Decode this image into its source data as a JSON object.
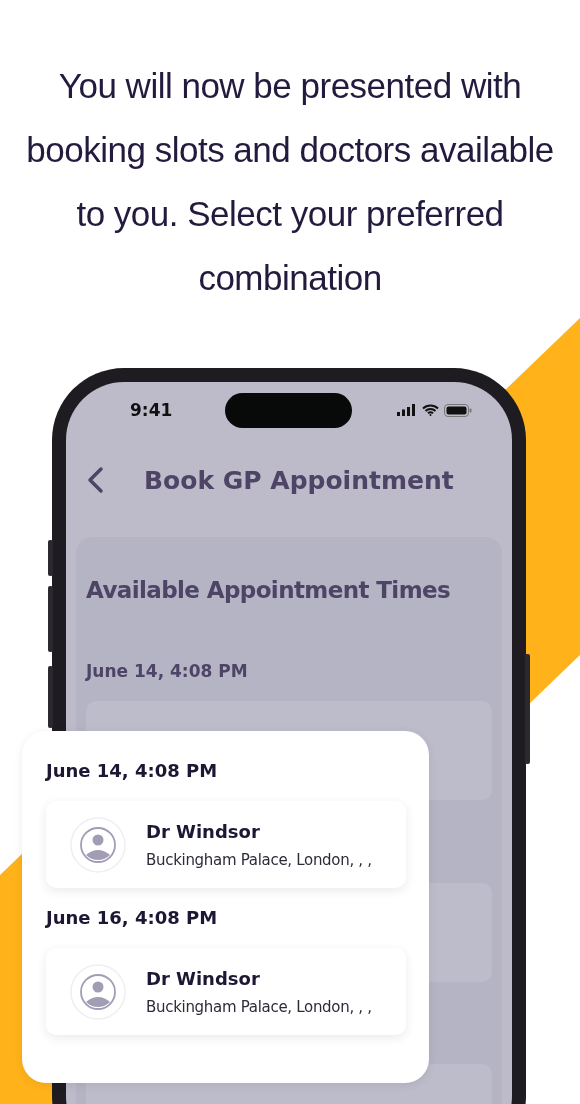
{
  "headline": "You will now be presented with booking slots and doctors available to you. Select your preferred combination",
  "phone": {
    "status_bar": {
      "time": "9:41"
    },
    "header": {
      "title": "Book GP Appointment"
    },
    "section_title": "Available Appointment Times",
    "first_date": "June 14, 4:08 PM"
  },
  "popup": {
    "slots": [
      {
        "date": "June 14, 4:08 PM",
        "doctor": "Dr Windsor",
        "address": "Buckingham Palace, London, , ,"
      },
      {
        "date": "June 16, 4:08 PM",
        "doctor": "Dr Windsor",
        "address": "Buckingham Palace, London, , ,"
      }
    ]
  }
}
